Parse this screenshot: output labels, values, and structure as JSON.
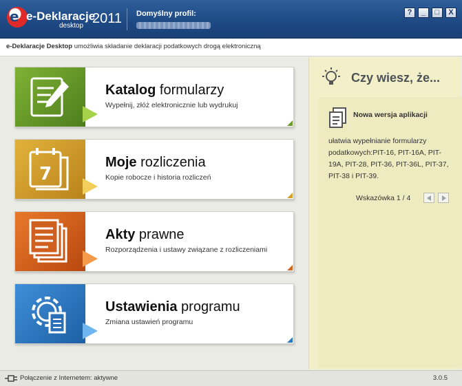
{
  "titlebar": {
    "brand": "e-Deklaracje",
    "brand_sub": "desktop",
    "year": "2011",
    "profile_label": "Domyślny profil:",
    "buttons": [
      "?",
      "_",
      "□",
      "X"
    ]
  },
  "infobar": {
    "app": "e-Deklaracje Desktop",
    "text": " umożliwia składanie deklaracji podatkowych drogą elektroniczną"
  },
  "cards": [
    {
      "title_bold": "Katalog",
      "title_rest": " formularzy",
      "desc": "Wypełnij, złóż elektronicznie lub wydrukuj",
      "color": "#6a9a2a",
      "icon": "document-edit-icon"
    },
    {
      "title_bold": "Moje",
      "title_rest": " rozliczenia",
      "desc": "Kopie robocze i historia rozliczeń",
      "color": "#d6a22a",
      "icon": "calendar-icon",
      "day": "7"
    },
    {
      "title_bold": "Akty",
      "title_rest": " prawne",
      "desc": "Rozporządzenia i ustawy związane z rozliczeniami",
      "color": "#d5651e",
      "icon": "legal-documents-icon"
    },
    {
      "title_bold": "Ustawienia",
      "title_rest": " programu",
      "desc": "Zmiana ustawień programu",
      "color": "#2b78c2",
      "icon": "settings-gear-icon"
    }
  ],
  "tips": {
    "title": "Czy wiesz, że...",
    "heading": "Nowa wersja aplikacji",
    "text": "ułatwia wypełnianie formularzy podatkowych:PIT-16, PIT-16A, PIT-19A, PIT-28, PIT-36, PIT-36L, PIT-37, PIT-38 i PIT-39.",
    "counter": "Wskazówka 1 / 4"
  },
  "status": {
    "connection": "Połączenie z Internetem: aktywne",
    "version": "3.0.5"
  }
}
